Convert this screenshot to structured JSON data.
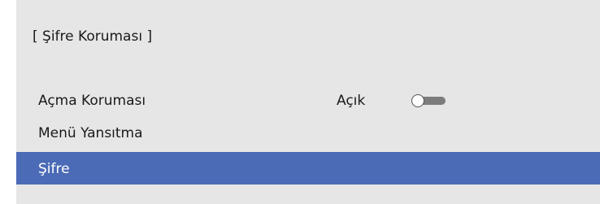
{
  "header": {
    "title": "[ Şifre Koruması ]"
  },
  "menu": {
    "items": [
      {
        "label": "Açma Koruması",
        "value": "Açık",
        "toggle_on": false
      },
      {
        "label": "Menü Yansıtma"
      },
      {
        "label": "Şifre",
        "selected": true
      }
    ]
  },
  "colors": {
    "panel_background": "#e6e6e6",
    "selected_row": "#4b6bb7",
    "toggle_track": "#7c7c7c"
  }
}
